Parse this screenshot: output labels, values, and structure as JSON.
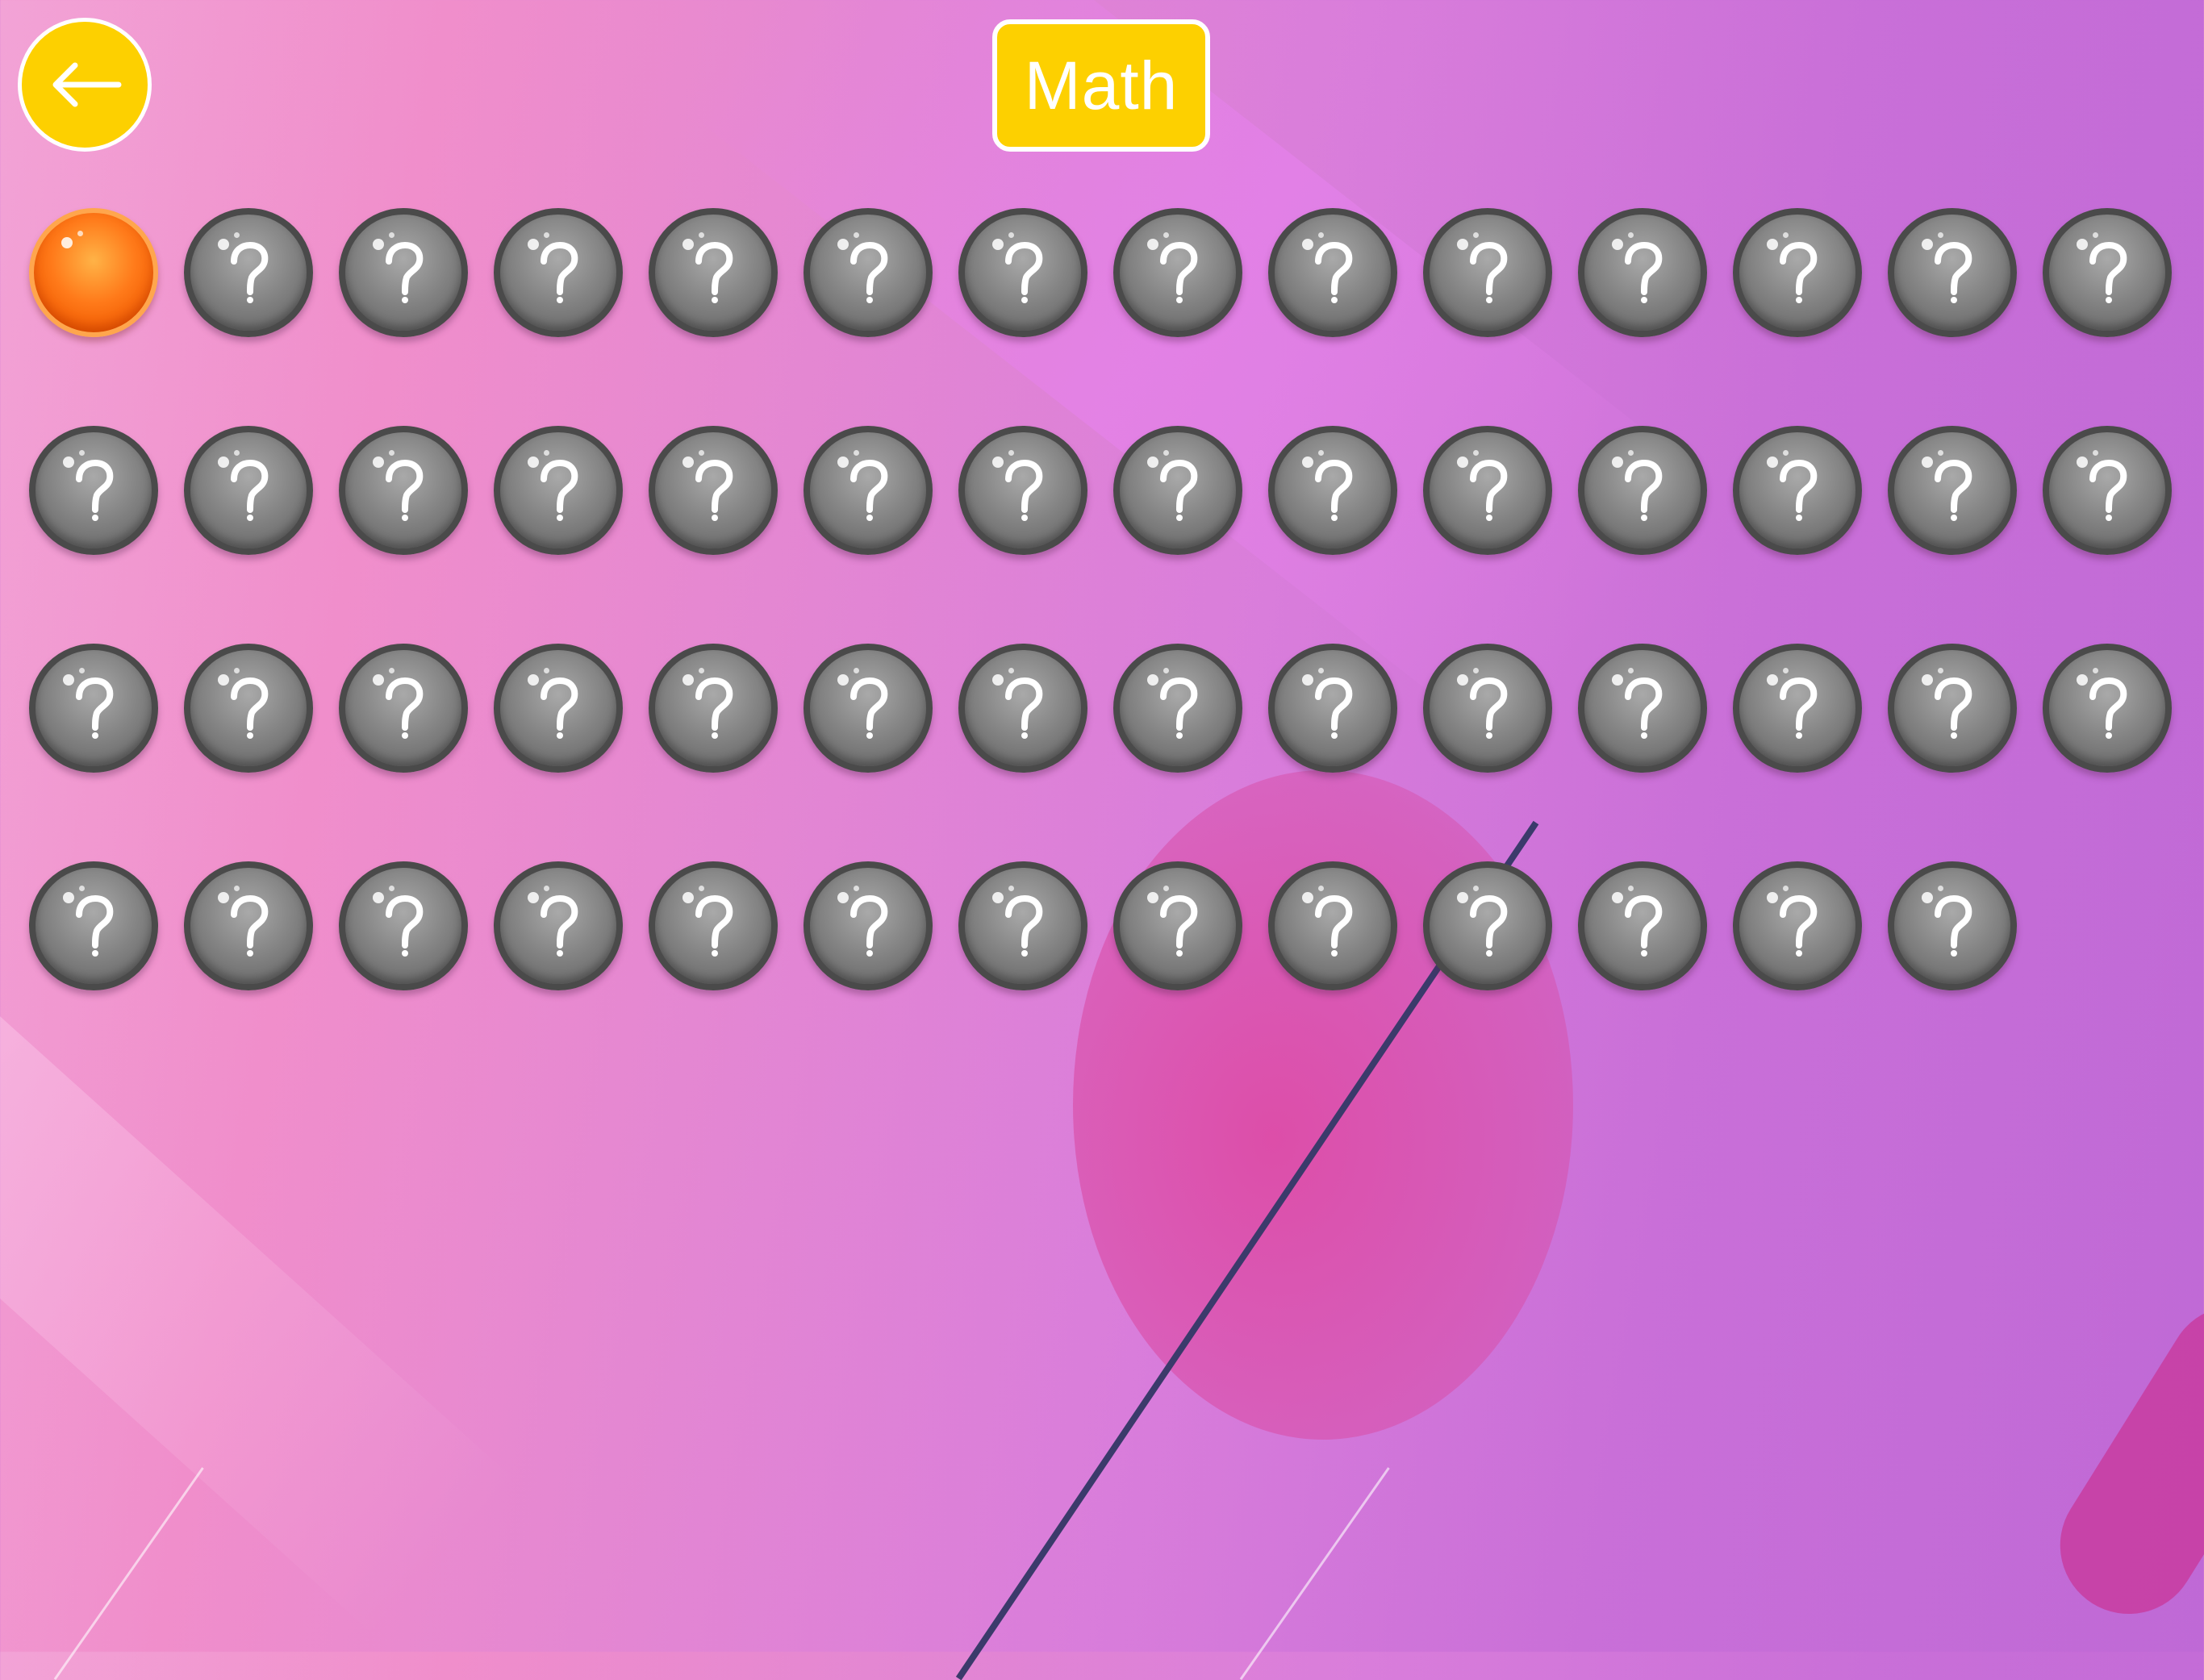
{
  "header": {
    "title": "Math",
    "back_icon": "arrow-left-icon"
  },
  "colors": {
    "badge": "#fdd000",
    "current_level": "#ff7a1a",
    "locked_level": "#7a7a7a"
  },
  "levels": {
    "total": 55,
    "current_index": 1,
    "locked_icon": "question-mark-icon"
  }
}
